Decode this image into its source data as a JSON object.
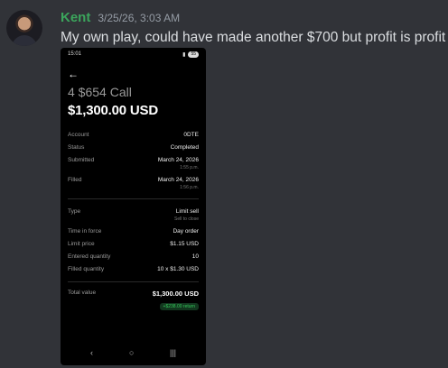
{
  "message": {
    "author": "Kent",
    "timestamp": "3/25/26, 3:03 AM",
    "text": "My own play, could have made another $700 but profit is profit",
    "author_color": "#3ba55c"
  },
  "phone": {
    "status_time": "15:01",
    "status_battery": "55",
    "title_contract": "4 $654 Call",
    "title_amount": "$1,300.00 USD",
    "details": [
      {
        "label": "Account",
        "value": "0DTE"
      },
      {
        "label": "Status",
        "value": "Completed"
      },
      {
        "label": "Submitted",
        "value": "March 24, 2026",
        "sub": "1:55 p.m."
      },
      {
        "label": "Filled",
        "value": "March 24, 2026",
        "sub": "1:56 p.m."
      }
    ],
    "order": [
      {
        "label": "Type",
        "value": "Limit sell",
        "sub": "Sell to close"
      },
      {
        "label": "Time in force",
        "value": "Day order"
      },
      {
        "label": "Limit price",
        "value": "$1.15 USD"
      },
      {
        "label": "Entered quantity",
        "value": "10"
      },
      {
        "label": "Filled quantity",
        "value": "10 x $1.30 USD"
      }
    ],
    "total_label": "Total value",
    "total_value": "$1,300.00 USD",
    "return_badge": "+$238.00 return",
    "return_color": "#34c759"
  }
}
